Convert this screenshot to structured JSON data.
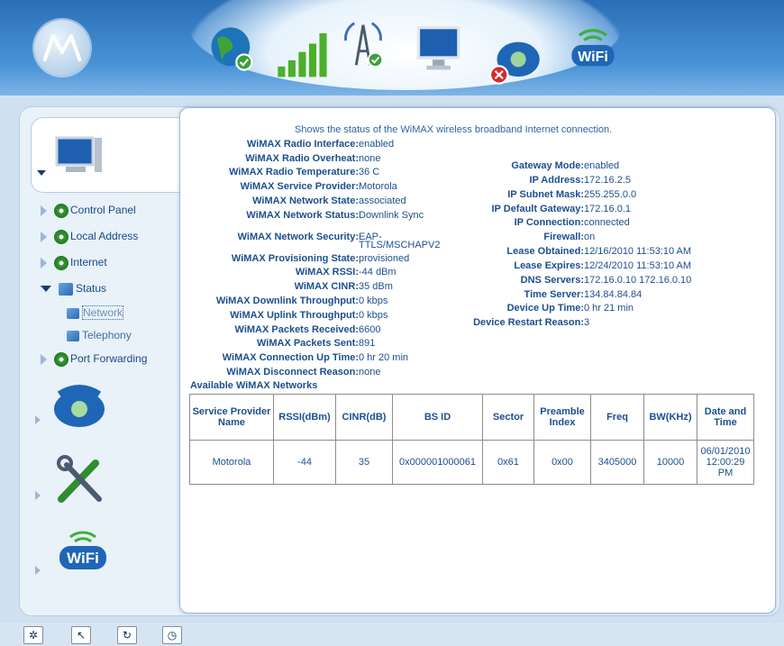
{
  "header": {
    "icons": [
      "globe-check-icon",
      "signal-bars-icon",
      "tower-check-icon",
      "monitor-icon",
      "phone-error-icon",
      "wifi-icon"
    ]
  },
  "sidebar": {
    "items": [
      {
        "label": "Control Panel",
        "icon": "gear-icon"
      },
      {
        "label": "Local Address",
        "icon": "gear-icon"
      },
      {
        "label": "Internet",
        "icon": "gear-icon"
      },
      {
        "label": "Status",
        "icon": "status-icon",
        "expanded": true
      },
      {
        "label": "Port Forwarding",
        "icon": "gear-icon"
      }
    ],
    "subitems": [
      {
        "label": "Network",
        "selected": true
      },
      {
        "label": "Telephony"
      }
    ],
    "sections": [
      "computer-icon",
      "telephone-icon",
      "tools-icon",
      "wifi-icon"
    ]
  },
  "content": {
    "intro": "Shows the status of the WiMAX wireless broadband Internet connection.",
    "left": [
      {
        "label": "WiMAX Radio Interface:",
        "value": "enabled"
      },
      {
        "label": "WiMAX Radio Overheat:",
        "value": "none"
      },
      {
        "label": "WiMAX Radio Temperature:",
        "value": "36 C"
      },
      {
        "label": "WiMAX Service Provider:",
        "value": "Motorola"
      },
      {
        "label": "WiMAX Network State:",
        "value": "associated"
      },
      {
        "label": "WiMAX Network Status:",
        "value": "Downlink Sync"
      },
      {
        "label": "WiMAX Network Security:",
        "value": "EAP-"
      },
      {
        "label": "WiMAX Provisioning State:",
        "value": "provisioned"
      },
      {
        "label": "WiMAX RSSI:",
        "value": "-44 dBm"
      },
      {
        "label": "WiMAX CINR:",
        "value": "35 dBm"
      },
      {
        "label": "WiMAX Downlink Throughput:",
        "value": "0 kbps"
      },
      {
        "label": "WiMAX Uplink Throughput:",
        "value": "0 kbps"
      },
      {
        "label": "WiMAX Packets Received:",
        "value": "6600"
      },
      {
        "label": "WiMAX Packets Sent:",
        "value": "891"
      },
      {
        "label": "WiMAX Connection Up Time:",
        "value": "0 hr 20 min"
      },
      {
        "label": "WiMAX Disconnect Reason:",
        "value": "none"
      }
    ],
    "security_line2": "TTLS/MSCHAPV2",
    "right": [
      {
        "label": "Gateway Mode:",
        "value": "enabled"
      },
      {
        "label": "IP Address:",
        "value": "172.16.2.5"
      },
      {
        "label": "IP Subnet Mask:",
        "value": "255.255.0.0"
      },
      {
        "label": "IP Default Gateway:",
        "value": "172.16.0.1"
      },
      {
        "label": "IP Connection:",
        "value": "connected"
      },
      {
        "label": "Firewall:",
        "value": "on"
      },
      {
        "label": "Lease Obtained:",
        "value": "12/16/2010 11:53:10 AM"
      },
      {
        "label": "Lease Expires:",
        "value": "12/24/2010 11:53:10 AM"
      },
      {
        "label": "DNS Servers:",
        "value": "172.16.0.10 172.16.0.10"
      },
      {
        "label": "Time Server:",
        "value": "134.84.84.84"
      },
      {
        "label": "Device Up Time:",
        "value": "0 hr 21 min"
      },
      {
        "label": "Device Restart Reason:",
        "value": "3"
      }
    ],
    "networks_title": "Available WiMAX Networks",
    "table": {
      "headers": [
        "Service Provider Name",
        "RSSI(dBm)",
        "CINR(dB)",
        "BS ID",
        "Sector",
        "Preamble Index",
        "Freq",
        "BW(KHz)",
        "Date and Time"
      ],
      "rows": [
        [
          "Motorola",
          "-44",
          "35",
          "0x000001000061",
          "0x61",
          "0x00",
          "3405000",
          "10000",
          "06/01/2010 12:00:29 PM"
        ]
      ]
    }
  },
  "bottom": {
    "buttons": [
      "sparkle-icon",
      "cursor-icon",
      "refresh-icon",
      "clock-icon"
    ]
  }
}
